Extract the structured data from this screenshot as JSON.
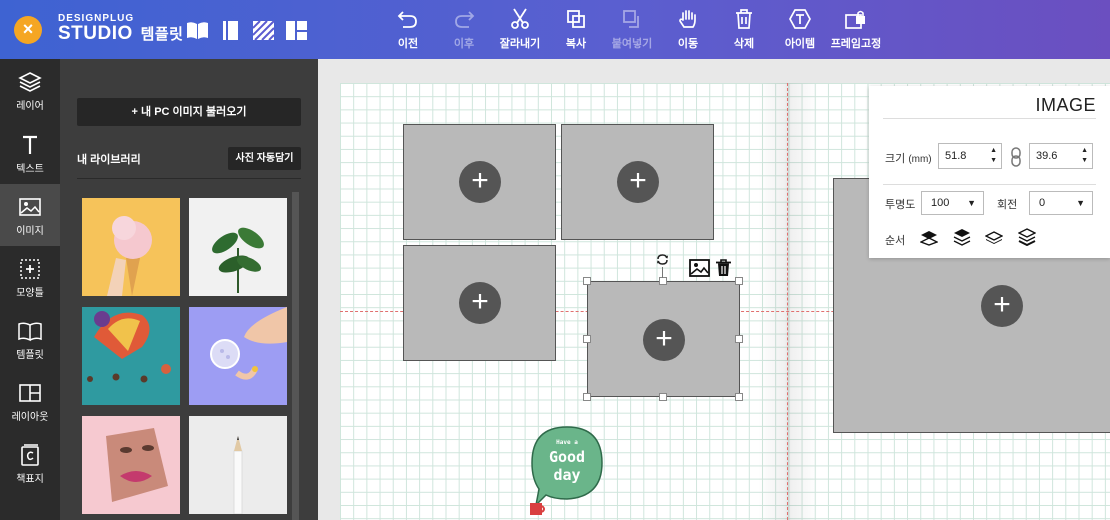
{
  "brand": {
    "small": "DESIGNPLUG",
    "big": "STUDIO",
    "template": "템플릿",
    "close_icon": "×"
  },
  "toolbar": [
    {
      "name": "undo",
      "label": "이전",
      "icon": "undo-icon",
      "enabled": true
    },
    {
      "name": "redo",
      "label": "이후",
      "icon": "redo-icon",
      "enabled": false
    },
    {
      "name": "cut",
      "label": "잘라내기",
      "icon": "scissors-icon",
      "enabled": true
    },
    {
      "name": "copy",
      "label": "복사",
      "icon": "copy-icon",
      "enabled": true
    },
    {
      "name": "paste",
      "label": "붙여넣기",
      "icon": "paste-icon",
      "enabled": false
    },
    {
      "name": "move",
      "label": "이동",
      "icon": "hand-icon",
      "enabled": true
    },
    {
      "name": "delete",
      "label": "삭제",
      "icon": "trash-icon",
      "enabled": true
    },
    {
      "name": "item",
      "label": "아이템",
      "icon": "t-badge-icon",
      "enabled": true
    },
    {
      "name": "lock-frame",
      "label": "프레임고정",
      "icon": "lock-frame-icon",
      "enabled": true
    }
  ],
  "rail": [
    {
      "label": "레이어",
      "icon": "layers-icon",
      "active": false
    },
    {
      "label": "텍스트",
      "icon": "text-icon",
      "active": false
    },
    {
      "label": "이미지",
      "icon": "image-icon",
      "active": true
    },
    {
      "label": "모양틀",
      "icon": "shape-frame-icon",
      "active": false
    },
    {
      "label": "템플릿",
      "icon": "book-icon",
      "active": false
    },
    {
      "label": "레이아웃",
      "icon": "layout-icon",
      "active": false
    },
    {
      "label": "책표지",
      "icon": "cover-icon",
      "active": false
    }
  ],
  "panel": {
    "load_button": "+ 내 PC 이미지 불러오기",
    "library_title": "내 라이브러리",
    "auto_button": "사진 자동담기"
  },
  "properties": {
    "title": "IMAGE",
    "size_label": "크기",
    "size_unit": "(mm)",
    "width": "51.8",
    "height": "39.6",
    "opacity_label": "투명도",
    "opacity": "100",
    "rotation_label": "회전",
    "rotation": "0",
    "order_label": "순서"
  },
  "sticker": {
    "line1": "Have a",
    "line2": "Good",
    "line3": "day"
  },
  "colors": {
    "accent": "#3e63d2",
    "close": "#f5a623",
    "frame": "#b9b9b9",
    "guide": "#e0706f",
    "sticker": "#6ab58a"
  }
}
